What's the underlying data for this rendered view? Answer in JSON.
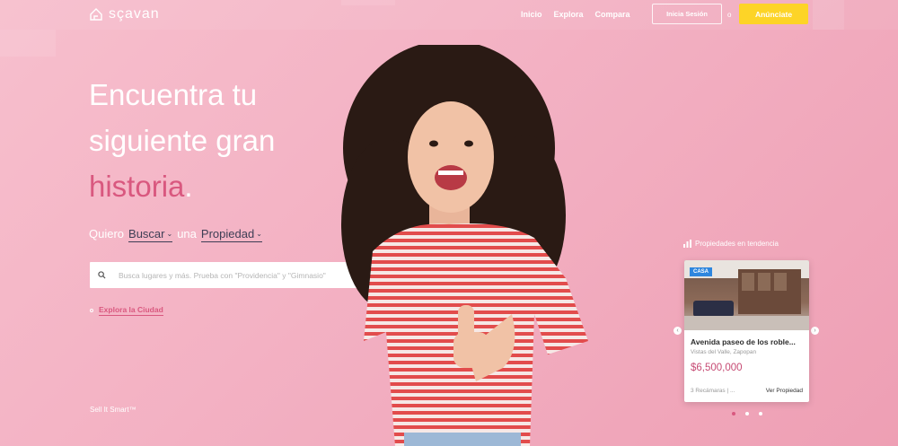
{
  "header": {
    "logo_text": "sçavan",
    "nav": [
      "Inicio",
      "Explora",
      "Compara"
    ],
    "login_label": "Inicia Sesión",
    "or_label": "o",
    "cta_label": "Anúnciate"
  },
  "hero": {
    "line1": "Encuentra tu",
    "line2": "siguiente gran",
    "line3_accent": "historia",
    "line3_dot": ".",
    "quiero_label": "Quiero",
    "action_select": "Buscar",
    "una_label": "una",
    "type_select": "Propiedad",
    "search_placeholder": "Busca lugares y más. Prueba con \"Providencia\" y \"Gimnasio\"",
    "explore_link": "Explora la Ciudad",
    "sell_label": "Sell It Smart™"
  },
  "trending": {
    "title": "Propiedades en tendencia",
    "card": {
      "badge": "CASA",
      "title": "Avenida paseo de los roble...",
      "location": "Vistas del Valle, Zapopan",
      "price": "$6,500,000",
      "rooms": "3 Recámaras | ...",
      "view_label": "Ver Propiedad"
    }
  },
  "colors": {
    "accent": "#d9587f",
    "cta": "#fdd427",
    "background": "#f3b1c3"
  }
}
